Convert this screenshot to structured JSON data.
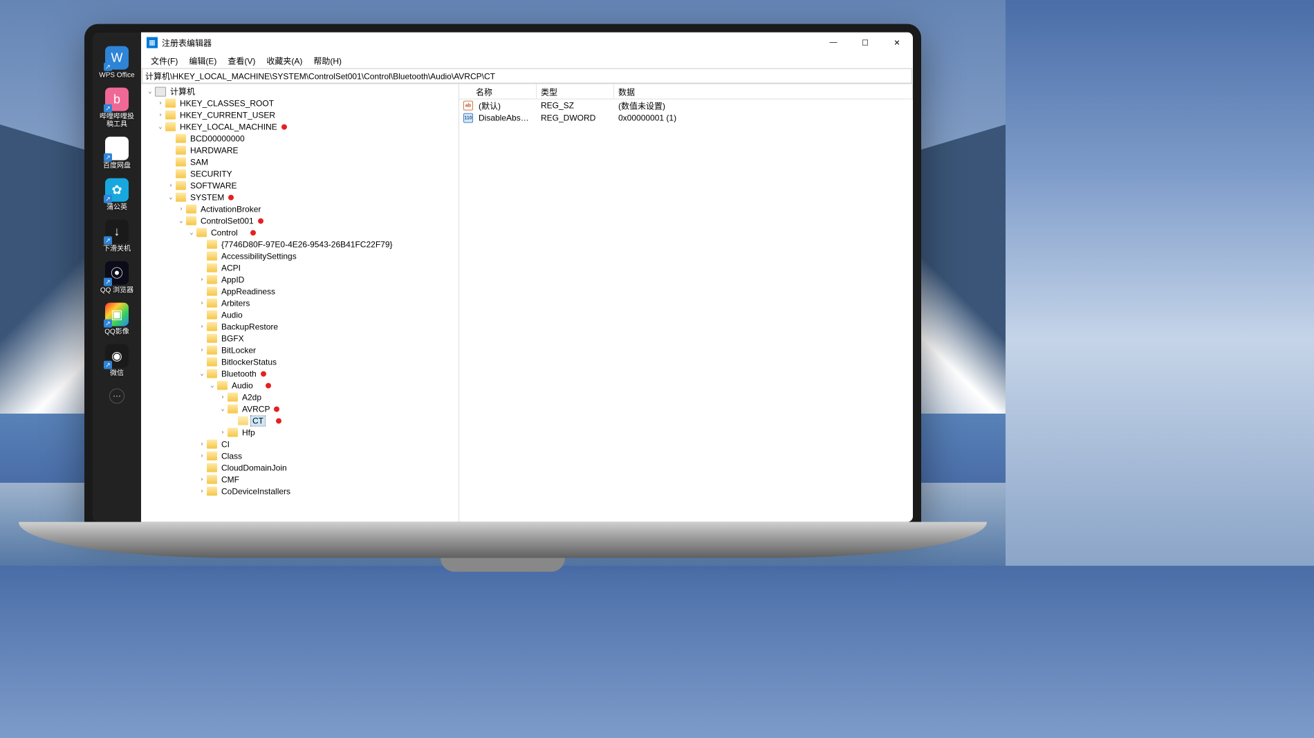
{
  "desktop_icons": [
    {
      "label": "WPS Office",
      "color": "#2e84d6",
      "glyph": "W"
    },
    {
      "label": "哔哩哔哩投稿工具",
      "color": "#f06896",
      "glyph": "b"
    },
    {
      "label": "百度网盘",
      "color": "#ffffff",
      "glyph": "∞"
    },
    {
      "label": "蒲公英",
      "color": "#17a8e0",
      "glyph": "✿"
    },
    {
      "label": "下滑关机",
      "color": "#1a1a1a",
      "glyph": "↓"
    },
    {
      "label": "QQ 浏览器",
      "color": "#0b0b1a",
      "glyph": "⦿"
    },
    {
      "label": "QQ影像",
      "color": "linear",
      "glyph": "▣"
    },
    {
      "label": "微信",
      "color": "#1a1a1a",
      "glyph": "◉"
    }
  ],
  "window": {
    "title": "注册表编辑器",
    "address": "计算机\\HKEY_LOCAL_MACHINE\\SYSTEM\\ControlSet001\\Control\\Bluetooth\\Audio\\AVRCP\\CT"
  },
  "menu": {
    "file": "文件(F)",
    "edit": "编辑(E)",
    "view": "查看(V)",
    "favorites": "收藏夹(A)",
    "help": "帮助(H)"
  },
  "tree": [
    {
      "indent": 0,
      "toggle": "v",
      "icon": "pc",
      "label": "计算机"
    },
    {
      "indent": 1,
      "toggle": ">",
      "icon": "folder",
      "label": "HKEY_CLASSES_ROOT"
    },
    {
      "indent": 1,
      "toggle": ">",
      "icon": "folder",
      "label": "HKEY_CURRENT_USER"
    },
    {
      "indent": 1,
      "toggle": "v",
      "icon": "folder",
      "label": "HKEY_LOCAL_MACHINE",
      "red": true
    },
    {
      "indent": 2,
      "toggle": "",
      "icon": "folder",
      "label": "BCD00000000"
    },
    {
      "indent": 2,
      "toggle": "",
      "icon": "folder",
      "label": "HARDWARE"
    },
    {
      "indent": 2,
      "toggle": "",
      "icon": "folder",
      "label": "SAM"
    },
    {
      "indent": 2,
      "toggle": "",
      "icon": "folder",
      "label": "SECURITY"
    },
    {
      "indent": 2,
      "toggle": ">",
      "icon": "folder",
      "label": "SOFTWARE"
    },
    {
      "indent": 2,
      "toggle": "v",
      "icon": "folder",
      "label": "SYSTEM",
      "red": true
    },
    {
      "indent": 3,
      "toggle": ">",
      "icon": "folder",
      "label": "ActivationBroker"
    },
    {
      "indent": 3,
      "toggle": "v",
      "icon": "folder",
      "label": "ControlSet001",
      "red": true
    },
    {
      "indent": 4,
      "toggle": "v",
      "icon": "folder",
      "label": "Control",
      "red": true,
      "redgap": true
    },
    {
      "indent": 5,
      "toggle": "",
      "icon": "folder",
      "label": "{7746D80F-97E0-4E26-9543-26B41FC22F79}"
    },
    {
      "indent": 5,
      "toggle": "",
      "icon": "folder",
      "label": "AccessibilitySettings"
    },
    {
      "indent": 5,
      "toggle": "",
      "icon": "folder",
      "label": "ACPI"
    },
    {
      "indent": 5,
      "toggle": ">",
      "icon": "folder",
      "label": "AppID"
    },
    {
      "indent": 5,
      "toggle": "",
      "icon": "folder",
      "label": "AppReadiness"
    },
    {
      "indent": 5,
      "toggle": ">",
      "icon": "folder",
      "label": "Arbiters"
    },
    {
      "indent": 5,
      "toggle": "",
      "icon": "folder",
      "label": "Audio"
    },
    {
      "indent": 5,
      "toggle": ">",
      "icon": "folder",
      "label": "BackupRestore"
    },
    {
      "indent": 5,
      "toggle": "",
      "icon": "folder",
      "label": "BGFX"
    },
    {
      "indent": 5,
      "toggle": ">",
      "icon": "folder",
      "label": "BitLocker"
    },
    {
      "indent": 5,
      "toggle": "",
      "icon": "folder",
      "label": "BitlockerStatus"
    },
    {
      "indent": 5,
      "toggle": "v",
      "icon": "folder",
      "label": "Bluetooth",
      "red": true
    },
    {
      "indent": 6,
      "toggle": "v",
      "icon": "folder",
      "label": "Audio",
      "red": true,
      "redgap": true
    },
    {
      "indent": 7,
      "toggle": ">",
      "icon": "folder",
      "label": "A2dp"
    },
    {
      "indent": 7,
      "toggle": "v",
      "icon": "folder",
      "label": "AVRCP",
      "red": true
    },
    {
      "indent": 8,
      "toggle": "",
      "icon": "open",
      "label": "CT",
      "selected": true,
      "red": true,
      "redgap": true
    },
    {
      "indent": 7,
      "toggle": ">",
      "icon": "folder",
      "label": "Hfp"
    },
    {
      "indent": 5,
      "toggle": ">",
      "icon": "folder",
      "label": "CI"
    },
    {
      "indent": 5,
      "toggle": ">",
      "icon": "folder",
      "label": "Class"
    },
    {
      "indent": 5,
      "toggle": "",
      "icon": "folder",
      "label": "CloudDomainJoin"
    },
    {
      "indent": 5,
      "toggle": ">",
      "icon": "folder",
      "label": "CMF"
    },
    {
      "indent": 5,
      "toggle": ">",
      "icon": "folder",
      "label": "CoDeviceInstallers"
    }
  ],
  "values_header": {
    "name": "名称",
    "type": "类型",
    "data": "数据"
  },
  "values": [
    {
      "icon": "sz",
      "name": "(默认)",
      "type": "REG_SZ",
      "data": "(数值未设置)"
    },
    {
      "icon": "dw",
      "name": "DisableAbsolut...",
      "type": "REG_DWORD",
      "data": "0x00000001 (1)"
    }
  ]
}
